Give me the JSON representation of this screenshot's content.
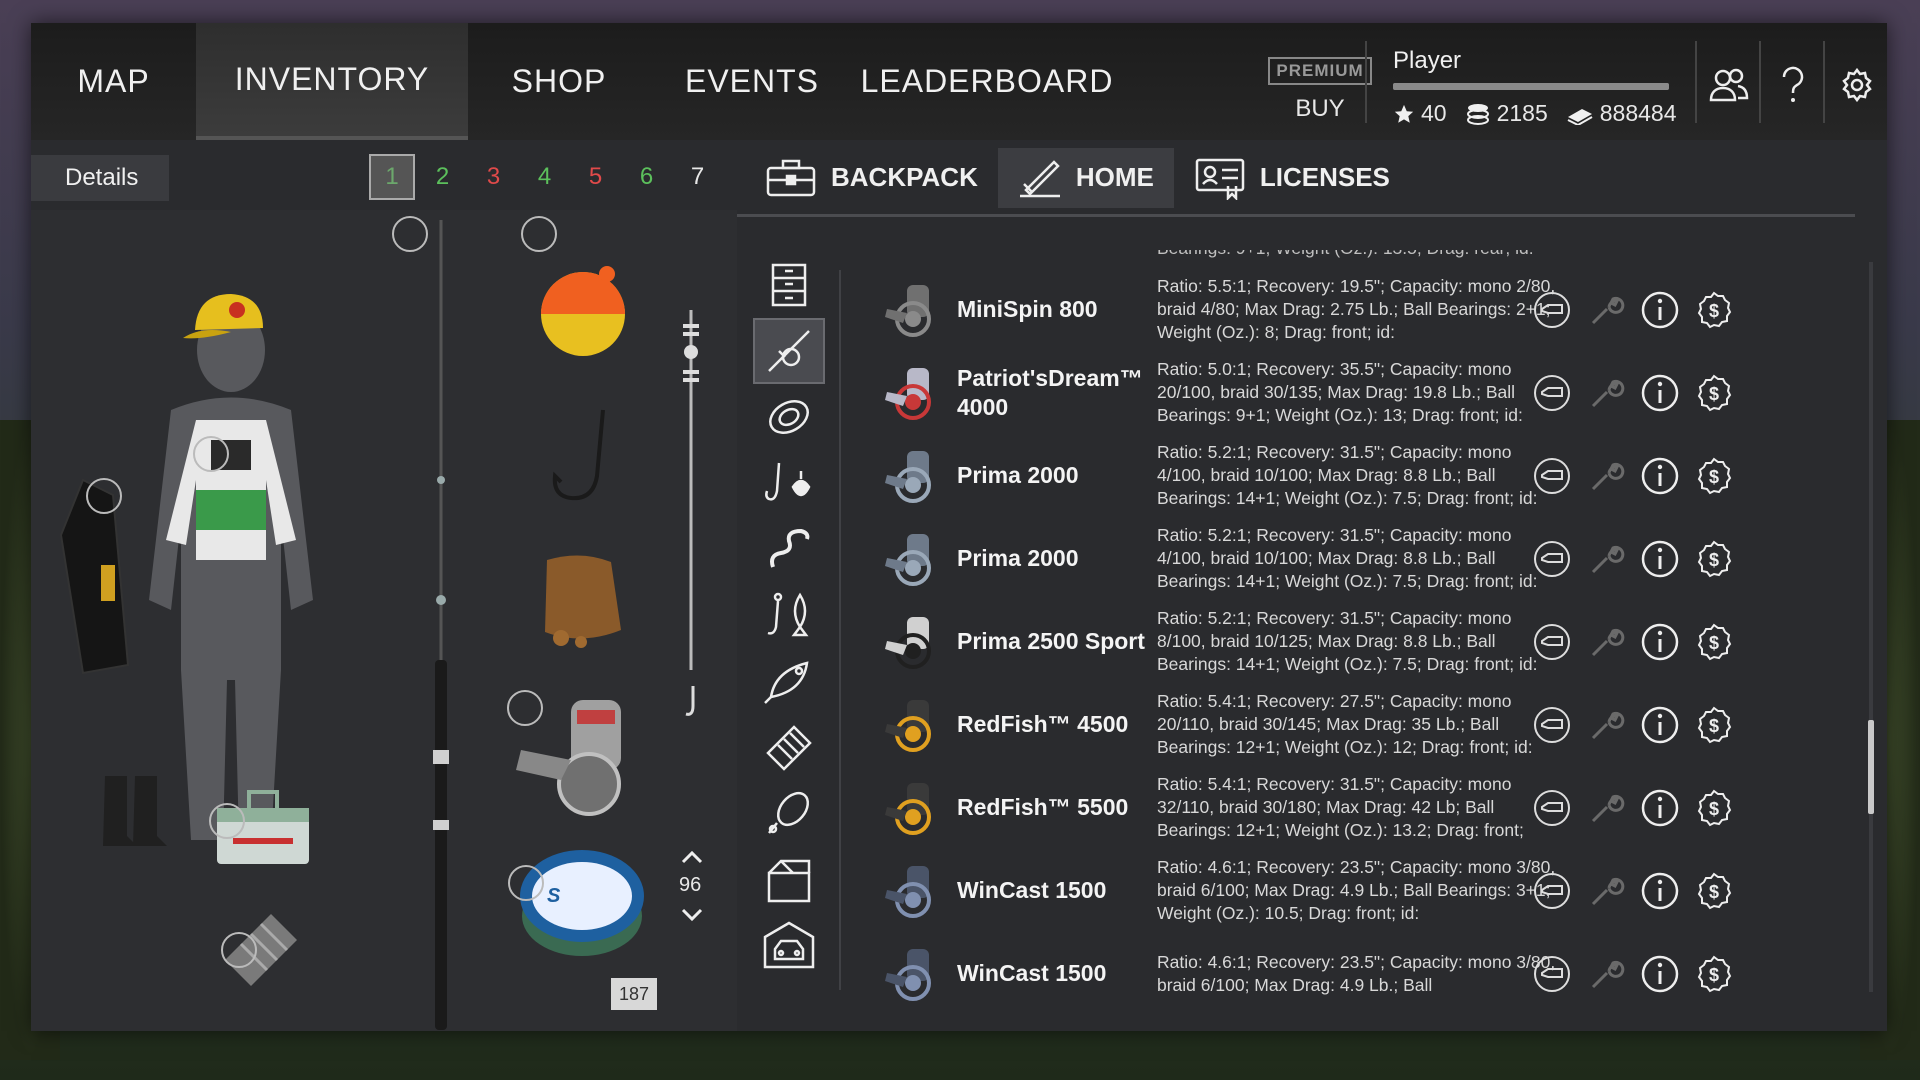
{
  "nav": {
    "tabs": [
      {
        "label": "MAP"
      },
      {
        "label": "INVENTORY"
      },
      {
        "label": "SHOP"
      },
      {
        "label": "EVENTS"
      },
      {
        "label": "LEADERBOARD"
      }
    ],
    "active_tab": "INVENTORY"
  },
  "premium": {
    "label": "PREMIUM",
    "buy_label": "BUY"
  },
  "player": {
    "name": "Player",
    "stars": "40",
    "silver": "2185",
    "gold": "888484",
    "xp_progress": 1.0
  },
  "left": {
    "details_label": "Details",
    "pages": [
      {
        "label": "1",
        "color": "#6ca86c"
      },
      {
        "label": "2",
        "color": "#5cc05c"
      },
      {
        "label": "3",
        "color": "#e04a4a"
      },
      {
        "label": "4",
        "color": "#5cc05c"
      },
      {
        "label": "5",
        "color": "#e04a4a"
      },
      {
        "label": "6",
        "color": "#5cc05c"
      },
      {
        "label": "7",
        "color": "#e8e8e8"
      }
    ],
    "line_length": "187",
    "depth_value": "96"
  },
  "storage_tabs": [
    {
      "label": "BACKPACK",
      "icon": "backpack-icon"
    },
    {
      "label": "HOME",
      "icon": "home-icon"
    },
    {
      "label": "LICENSES",
      "icon": "license-icon"
    }
  ],
  "active_storage": "HOME",
  "categories": [
    "drawer",
    "rod",
    "line",
    "tackle",
    "worm",
    "lure",
    "fish",
    "feeder",
    "spoon",
    "box",
    "car"
  ],
  "reels": {
    "partial_top": "Bearings: 9+1; Weight (Oz.): 13.5; Drag: rear; id:",
    "items": [
      {
        "name": "MiniSpin 800",
        "desc": "Ratio: 5.5:1; Recovery: 19.5\"; Capacity: mono 2/80, braid 4/80; Max Drag: 2.75 Lb.; Ball Bearings: 2+1; Weight (Oz.): 8; Drag: front; id:",
        "body": "#707070",
        "accent": "#8a8a8a"
      },
      {
        "name": "Patriot'sDream™ 4000",
        "desc": "Ratio: 5.0:1; Recovery: 35.5\"; Capacity: mono 20/100, braid 30/135; Max Drag: 19.8 Lb.; Ball Bearings: 9+1; Weight (Oz.): 13; Drag: front; id:",
        "body": "#b8b8c8",
        "accent": "#c83838"
      },
      {
        "name": "Prima 2000",
        "desc": "Ratio: 5.2:1; Recovery: 31.5\"; Capacity: mono 4/100, braid 10/100; Max Drag: 8.8 Lb.; Ball Bearings: 14+1; Weight (Oz.): 7.5; Drag: front; id:",
        "body": "#6e7a8a",
        "accent": "#9aa8b8"
      },
      {
        "name": "Prima 2000",
        "desc": "Ratio: 5.2:1; Recovery: 31.5\"; Capacity: mono 4/100, braid 10/100; Max Drag: 8.8 Lb.; Ball Bearings: 14+1; Weight (Oz.): 7.5; Drag: front; id:",
        "body": "#6e7a8a",
        "accent": "#9aa8b8"
      },
      {
        "name": "Prima 2500 Sport",
        "desc": "Ratio: 5.2:1; Recovery: 31.5\"; Capacity: mono 8/100, braid 10/125; Max Drag: 8.8 Lb.; Ball Bearings: 14+1; Weight (Oz.): 7.5; Drag: front; id:",
        "body": "#d0d0d0",
        "accent": "#202020"
      },
      {
        "name": "RedFish™ 4500",
        "desc": "Ratio: 5.4:1; Recovery: 27.5\"; Capacity: mono 20/110, braid 30/145; Max Drag: 35 Lb.; Ball Bearings: 12+1; Weight (Oz.): 12; Drag: front; id:",
        "body": "#3a3a3a",
        "accent": "#e0a020"
      },
      {
        "name": "RedFish™ 5500",
        "desc": "Ratio: 5.4:1; Recovery: 31.5\"; Capacity: mono 32/110, braid 30/180; Max Drag: 42 Lb; Ball Bearings: 12+1; Weight (Oz.): 13.2; Drag: front;",
        "body": "#3a3a3a",
        "accent": "#e0a020"
      },
      {
        "name": "WinCast 1500",
        "desc": "Ratio: 4.6:1; Recovery: 23.5\"; Capacity: mono 3/80, braid 6/100; Max Drag: 4.9 Lb.; Ball Bearings: 3+1; Weight (Oz.): 10.5; Drag: front; id:",
        "body": "#4a5468",
        "accent": "#8090b0"
      },
      {
        "name": "WinCast 1500",
        "desc": "Ratio: 4.6:1; Recovery: 23.5\"; Capacity: mono 3/80, braid 6/100; Max Drag: 4.9 Lb.; Ball",
        "body": "#4a5468",
        "accent": "#8090b0"
      }
    ]
  },
  "scroll_position": 0.72
}
